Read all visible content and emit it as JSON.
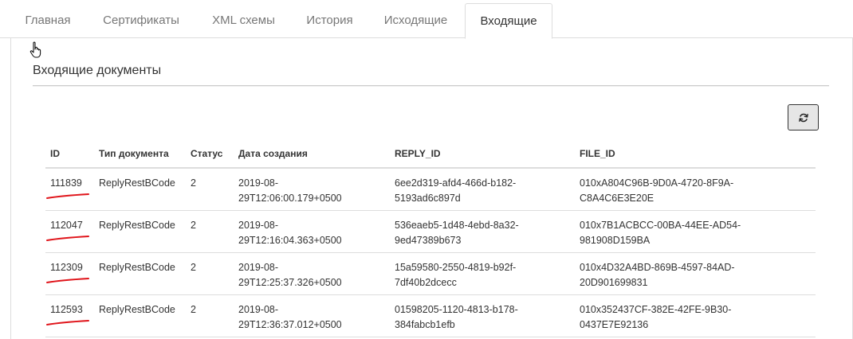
{
  "tabs": [
    {
      "label": "Главная"
    },
    {
      "label": "Сертификаты"
    },
    {
      "label": "XML схемы"
    },
    {
      "label": "История"
    },
    {
      "label": "Исходящие"
    },
    {
      "label": "Входящие",
      "active": true
    }
  ],
  "section": {
    "title": "Входящие документы"
  },
  "toolbar": {
    "refresh_icon": "refresh-icon"
  },
  "table": {
    "headers": {
      "id": "ID",
      "type": "Тип документа",
      "status": "Статус",
      "date": "Дата создания",
      "reply_id": "REPLY_ID",
      "file_id": "FILE_ID"
    },
    "rows": [
      {
        "id": "111839",
        "type": "ReplyRestBCode",
        "status": "2",
        "date": "2019-08-\n29T12:06:00.179+0500",
        "reply_id": "6ee2d319-afd4-466d-b182-\n5193ad6c897d",
        "file_id": "010xA804C96B-9D0A-4720-8F9A-\nC8A4C6E3E20E"
      },
      {
        "id": "112047",
        "type": "ReplyRestBCode",
        "status": "2",
        "date": "2019-08-\n29T12:16:04.363+0500",
        "reply_id": "536eaeb5-1d48-4ebd-8a32-\n9ed47389b673",
        "file_id": "010x7B1ACBCC-00BA-44EE-AD54-\n981908D159BA"
      },
      {
        "id": "112309",
        "type": "ReplyRestBCode",
        "status": "2",
        "date": "2019-08-\n29T12:25:37.326+0500",
        "reply_id": "15a59580-2550-4819-b92f-\n7df40b2dcecc",
        "file_id": "010x4D32A4BD-869B-4597-84AD-\n20D901699831"
      },
      {
        "id": "112593",
        "type": "ReplyRestBCode",
        "status": "2",
        "date": "2019-08-\n29T12:36:37.012+0500",
        "reply_id": "01598205-1120-4813-b178-\n384fabcb1efb",
        "file_id": "010x352437CF-382E-42FE-9B30-\n0437E7E92136"
      }
    ]
  },
  "annotation_color": "#e0151b"
}
